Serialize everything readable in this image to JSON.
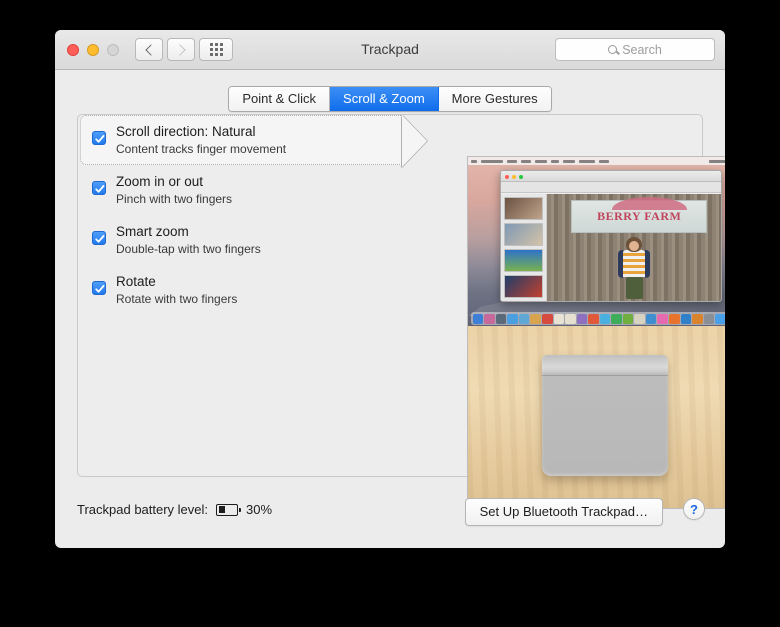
{
  "window": {
    "title": "Trackpad",
    "traffic_lights": [
      "close",
      "minimize",
      "zoom"
    ],
    "nav": {
      "back_icon": "chevron-left-icon",
      "forward_icon": "chevron-right-icon",
      "grid_icon": "grid-dots-icon"
    },
    "search": {
      "placeholder": "Search",
      "icon": "search-icon",
      "value": ""
    }
  },
  "tabs": [
    {
      "label": "Point & Click",
      "active": false
    },
    {
      "label": "Scroll & Zoom",
      "active": true
    },
    {
      "label": "More Gestures",
      "active": false
    }
  ],
  "options": [
    {
      "title": "Scroll direction: Natural",
      "subtitle": "Content tracks finger movement",
      "checked": true,
      "highlighted": true
    },
    {
      "title": "Zoom in or out",
      "subtitle": "Pinch with two fingers",
      "checked": true,
      "highlighted": false
    },
    {
      "title": "Smart zoom",
      "subtitle": "Double-tap with two fingers",
      "checked": true,
      "highlighted": false
    },
    {
      "title": "Rotate",
      "subtitle": "Rotate with two fingers",
      "checked": true,
      "highlighted": false
    }
  ],
  "preview": {
    "top_scene": "macos-desktop-preview-app",
    "bottom_scene": "magic-trackpad-on-wood-desk",
    "desktop_window_sign_text": "BERRY FARM"
  },
  "bottom": {
    "battery_label": "Trackpad battery level:",
    "battery_percent": "30%",
    "battery_fill": 30,
    "battery_icon": "battery-icon",
    "setup_button": "Set Up Bluetooth Trackpad…",
    "help_button": "?"
  },
  "colors": {
    "accent_blue": "#1f6ceb",
    "checkbox_blue": "#2279ee",
    "window_chrome": "#ececec",
    "panel_bg": "#ededed",
    "help_blue": "#1d6ae0"
  }
}
